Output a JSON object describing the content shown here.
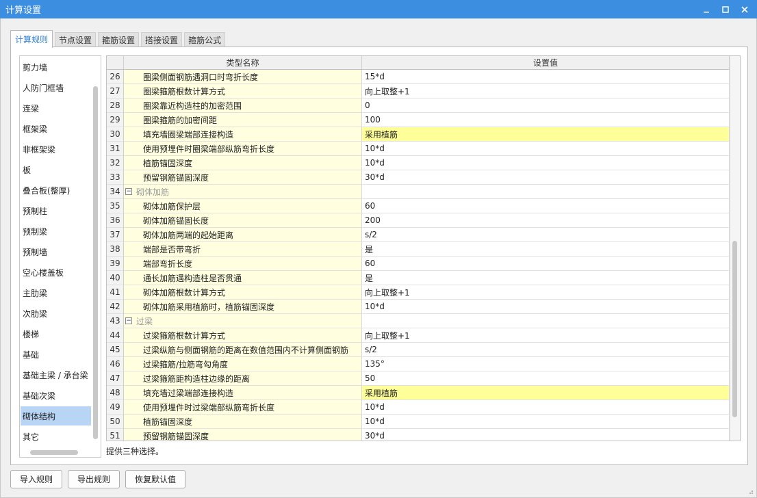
{
  "window": {
    "title": "计算设置"
  },
  "tabs": [
    "计算规则",
    "节点设置",
    "箍筋设置",
    "搭接设置",
    "箍筋公式"
  ],
  "left_list": {
    "items": [
      "剪力墙",
      "人防门框墙",
      "连梁",
      "框架梁",
      "非框架梁",
      "板",
      "叠合板(整厚)",
      "预制柱",
      "预制梁",
      "预制墙",
      "空心楼盖板",
      "主肋梁",
      "次肋梁",
      "楼梯",
      "基础",
      "基础主梁 / 承台梁",
      "基础次梁",
      "砌体结构",
      "其它"
    ],
    "selected": "砌体结构"
  },
  "grid": {
    "headers": {
      "name": "类型名称",
      "value": "设置值"
    },
    "rows": [
      {
        "num": "26",
        "name": "圈梁侧面钢筋遇洞口时弯折长度",
        "value": "15*d"
      },
      {
        "num": "27",
        "name": "圈梁箍筋根数计算方式",
        "value": "向上取整+1"
      },
      {
        "num": "28",
        "name": "圈梁靠近构造柱的加密范围",
        "value": "0"
      },
      {
        "num": "29",
        "name": "圈梁箍筋的加密间距",
        "value": "100"
      },
      {
        "num": "30",
        "name": "填充墙圈梁端部连接构造",
        "value": "采用植筋",
        "highlight": true
      },
      {
        "num": "31",
        "name": "使用预埋件时圈梁端部纵筋弯折长度",
        "value": "10*d"
      },
      {
        "num": "32",
        "name": "植筋锚固深度",
        "value": "10*d"
      },
      {
        "num": "33",
        "name": "预留钢筋锚固深度",
        "value": "30*d"
      },
      {
        "num": "34",
        "name": "砌体加筋",
        "value": "",
        "group": true,
        "toggle": "−"
      },
      {
        "num": "35",
        "name": "砌体加筋保护层",
        "value": "60"
      },
      {
        "num": "36",
        "name": "砌体加筋锚固长度",
        "value": "200"
      },
      {
        "num": "37",
        "name": "砌体加筋两端的起始距离",
        "value": "s/2"
      },
      {
        "num": "38",
        "name": "端部是否带弯折",
        "value": "是"
      },
      {
        "num": "39",
        "name": "端部弯折长度",
        "value": "60"
      },
      {
        "num": "40",
        "name": "通长加筋遇构造柱是否贯通",
        "value": "是"
      },
      {
        "num": "41",
        "name": "砌体加筋根数计算方式",
        "value": "向上取整+1"
      },
      {
        "num": "42",
        "name": "砌体加筋采用植筋时，植筋锚固深度",
        "value": "10*d"
      },
      {
        "num": "43",
        "name": "过梁",
        "value": "",
        "group": true,
        "toggle": "−"
      },
      {
        "num": "44",
        "name": "过梁箍筋根数计算方式",
        "value": "向上取整+1"
      },
      {
        "num": "45",
        "name": "过梁纵筋与侧面钢筋的距离在数值范围内不计算侧面钢筋",
        "value": "s/2"
      },
      {
        "num": "46",
        "name": "过梁箍筋/拉筋弯勾角度",
        "value": "135°"
      },
      {
        "num": "47",
        "name": "过梁箍筋距构造柱边缘的距离",
        "value": "50"
      },
      {
        "num": "48",
        "name": "填充墙过梁端部连接构造",
        "value": "采用植筋",
        "highlight": true
      },
      {
        "num": "49",
        "name": "使用预埋件时过梁端部纵筋弯折长度",
        "value": "10*d"
      },
      {
        "num": "50",
        "name": "植筋锚固深度",
        "value": "10*d"
      },
      {
        "num": "51",
        "name": "预留钢筋锚固深度",
        "value": "30*d"
      }
    ]
  },
  "hint": "提供三种选择。",
  "buttons": {
    "import": "导入规则",
    "export": "导出规则",
    "restore": "恢复默认值"
  },
  "colors": {
    "titlebar": "#3c8fe0",
    "name_cell_bg": "#ffffe0",
    "highlight_bg": "#ffff99",
    "selected_item_bg": "#b9d5f5",
    "active_tab_text": "#2f7fd6"
  },
  "icons": {
    "minimize": "minimize-icon",
    "maximize": "maximize-icon",
    "close": "close-icon",
    "collapse": "collapse-toggle-icon"
  }
}
